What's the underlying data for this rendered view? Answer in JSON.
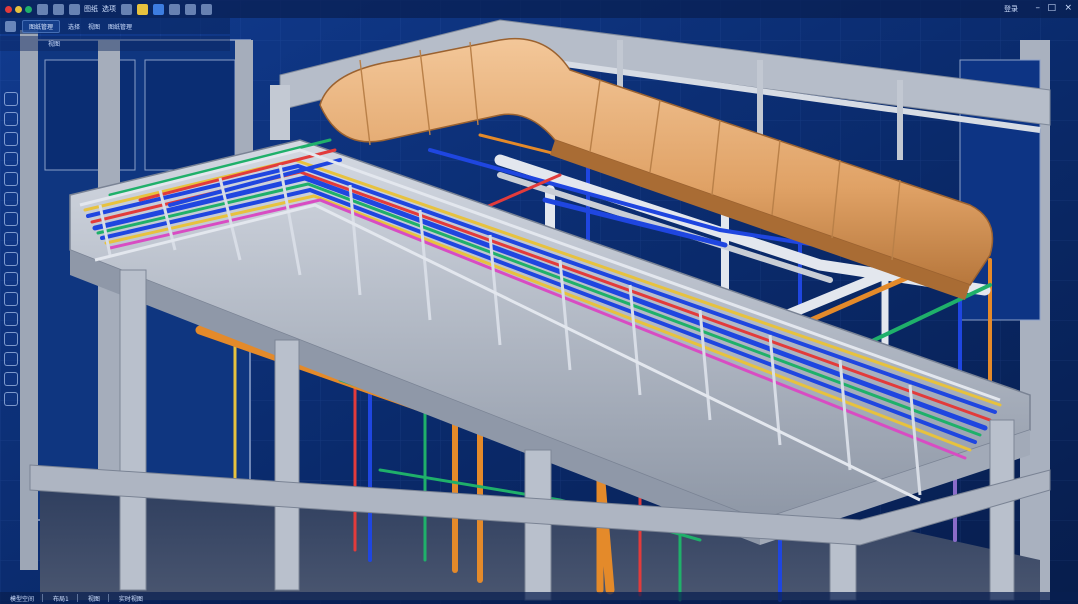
{
  "titlebar": {
    "menu_items": [
      "图纸",
      "选项"
    ],
    "user_label": "登录"
  },
  "toolbar2": {
    "field_1": "图纸管理",
    "label_1": "选择",
    "label_2": "视图",
    "label_3": "图纸管理"
  },
  "toolbar3": {
    "label": "视图"
  },
  "statusbar": {
    "items": [
      "模型空间",
      "布局1",
      "视图",
      "实时视图"
    ]
  },
  "colors": {
    "accent": "#2f6fe0",
    "duct": "#e4aa72",
    "pipe_orange": "#e48a2a",
    "pipe_blue": "#1f46e0",
    "pipe_green": "#1fb06a",
    "pipe_red": "#e23b3b",
    "pipe_yellow": "#e7c23e",
    "structure": "#c8ced8"
  },
  "icons": [
    "close-icon",
    "minimize-icon",
    "maximize-icon",
    "save-icon",
    "undo-icon",
    "redo-icon",
    "layers-icon",
    "measure-icon",
    "settings-icon"
  ]
}
